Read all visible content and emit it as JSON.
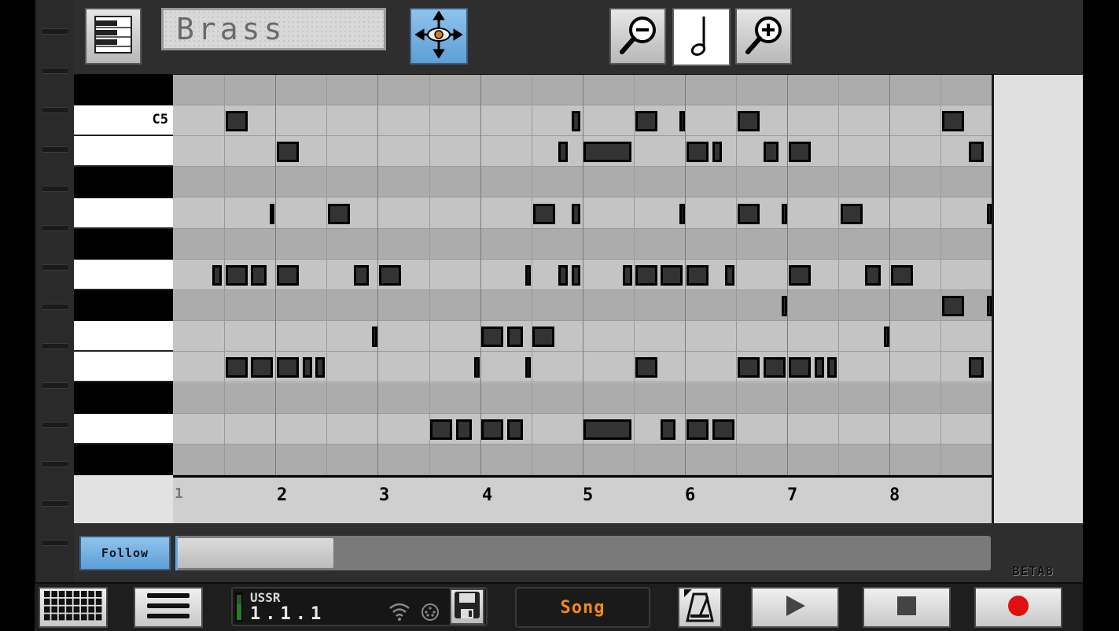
{
  "toolbar": {
    "instrument_name": "Brass",
    "icons": [
      "piano-icon",
      "move-view-icon",
      "zoom-out-icon",
      "note-length-icon",
      "zoom-in-icon"
    ]
  },
  "piano": {
    "labeled_key": "C5"
  },
  "ruler": {
    "bars": [
      "1",
      "2",
      "3",
      "4",
      "5",
      "6",
      "7",
      "8"
    ]
  },
  "follow": {
    "label": "Follow"
  },
  "beta": "BETA8",
  "status": {
    "project_name": "USSR",
    "position": "1.1.1"
  },
  "transport": {
    "song_label": "Song",
    "icons": [
      "grid-icon",
      "menu-icon",
      "wifi-icon",
      "midi-icon",
      "save-icon",
      "metronome-icon",
      "play-icon",
      "stop-icon",
      "record-icon"
    ],
    "record_color": "#e01010"
  },
  "colors": {
    "accent_blue": "#5d9fd6",
    "song_orange": "#f28a1a"
  }
}
